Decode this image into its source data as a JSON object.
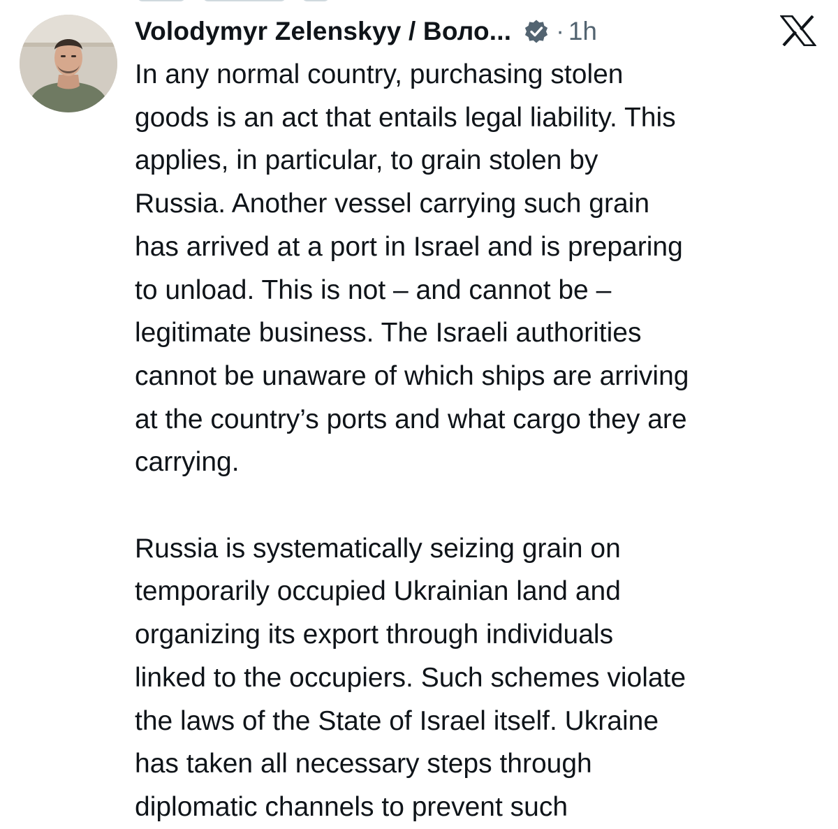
{
  "tweet": {
    "author": "Volodymyr Zelenskyy / Воло...",
    "verified_icon": "verified-badge-icon",
    "separator": "·",
    "time": "1h",
    "platform_icon": "x-logo-icon",
    "paragraphs": [
      "In any normal country, purchasing stolen\ngoods is an act that entails legal liability. This\napplies, in particular, to grain stolen by\nRussia. Another vessel carrying such grain\nhas arrived at a port in Israel and is preparing\nto unload. This is not – and cannot be –\nlegitimate business. The Israeli authorities\ncannot be unaware of which ships are arriving\nat the country’s ports and what cargo they are\ncarrying.",
      "Russia is systematically seizing grain on\ntemporarily occupied Ukrainian land and\norganizing its export through individuals\nlinked to the occupiers. Such schemes violate\nthe laws of the State of Israel itself. Ukraine\nhas taken all necessary steps through\ndiplomatic channels to prevent such"
    ]
  },
  "colors": {
    "text": "#0f1419",
    "secondary": "#536471",
    "background": "#ffffff",
    "badge": "#536471"
  }
}
